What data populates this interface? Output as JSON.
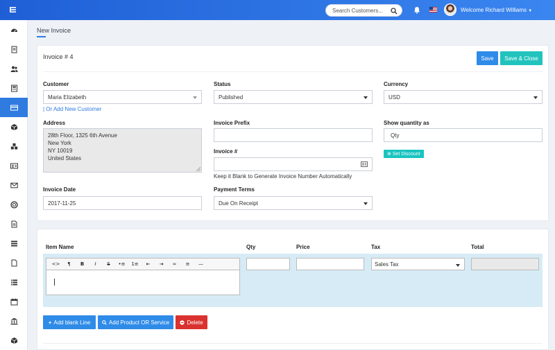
{
  "topbar": {
    "search_placeholder": "Search Customers...",
    "welcome": "Welcome Richard Williams"
  },
  "page": {
    "title": "New Invoice"
  },
  "invoice": {
    "number_label": "Invoice # 4",
    "save": "Save",
    "save_close": "Save & Close",
    "customer_label": "Customer",
    "customer_value": "Maria Elizabeth",
    "add_customer_link": "| Or Add New Customer",
    "status_label": "Status",
    "status_value": "Published",
    "currency_label": "Currency",
    "currency_value": "USD",
    "address_label": "Address",
    "address_lines": [
      "28th Floor, 1325 6th Avenue",
      "New York",
      "NY 10019",
      "United States"
    ],
    "prefix_label": "Invoice Prefix",
    "prefix_value": "",
    "invoice_no_label": "Invoice #",
    "invoice_no_value": "",
    "invoice_no_help": "Keep it Blank to Generate Invoice Number Automatically",
    "show_qty_label": "Show quantity as",
    "show_qty_value": "Qty",
    "set_discount": "Set Discount",
    "date_label": "Invoice Date",
    "date_value": "2017-11-25",
    "terms_label": "Payment Terms",
    "terms_value": "Due On Receipt"
  },
  "items": {
    "headers": {
      "name": "Item Name",
      "qty": "Qty",
      "price": "Price",
      "tax": "Tax",
      "total": "Total"
    },
    "tax_value": "Sales Tax",
    "toolbar": [
      "<>",
      "¶",
      "B",
      "I",
      "S",
      "•≡",
      "1≡",
      "⇤",
      "⇥",
      "∞",
      "≡",
      "—"
    ],
    "add_blank": "Add blank Line",
    "add_product": "Add Product OR Service",
    "delete": "Delete"
  },
  "colors": {
    "primary": "#2f7be0",
    "teal": "#19c4c0",
    "danger": "#d9322f",
    "topbar": "#2a72e5"
  }
}
